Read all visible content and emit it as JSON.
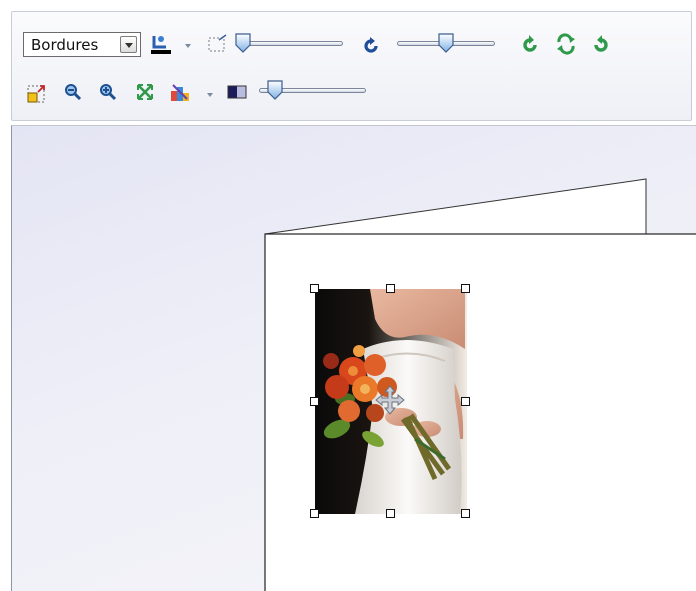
{
  "toolbar": {
    "border_select": {
      "value": "Bordures"
    },
    "row1_icons": [
      "border-color-icon",
      "crop-icon",
      "rotate-icon",
      "rotate-left-icon",
      "rotate-both-icon",
      "rotate-right-icon"
    ],
    "row2_icons": [
      "resize-icon",
      "zoom-out-icon",
      "zoom-in-icon",
      "fit-icon",
      "color-adjust-icon",
      "contrast-icon"
    ],
    "sliders": {
      "crop_level": 0.05,
      "rotation_level": 0.5,
      "contrast_level": 0.15
    }
  },
  "canvas": {
    "photo": {
      "subject": "bride-with-bouquet",
      "selected": true
    }
  },
  "colors": {
    "workspace_bg": "#e9eaf5",
    "accent_green": "#2f9a4a",
    "accent_blue": "#1f5aa8"
  }
}
